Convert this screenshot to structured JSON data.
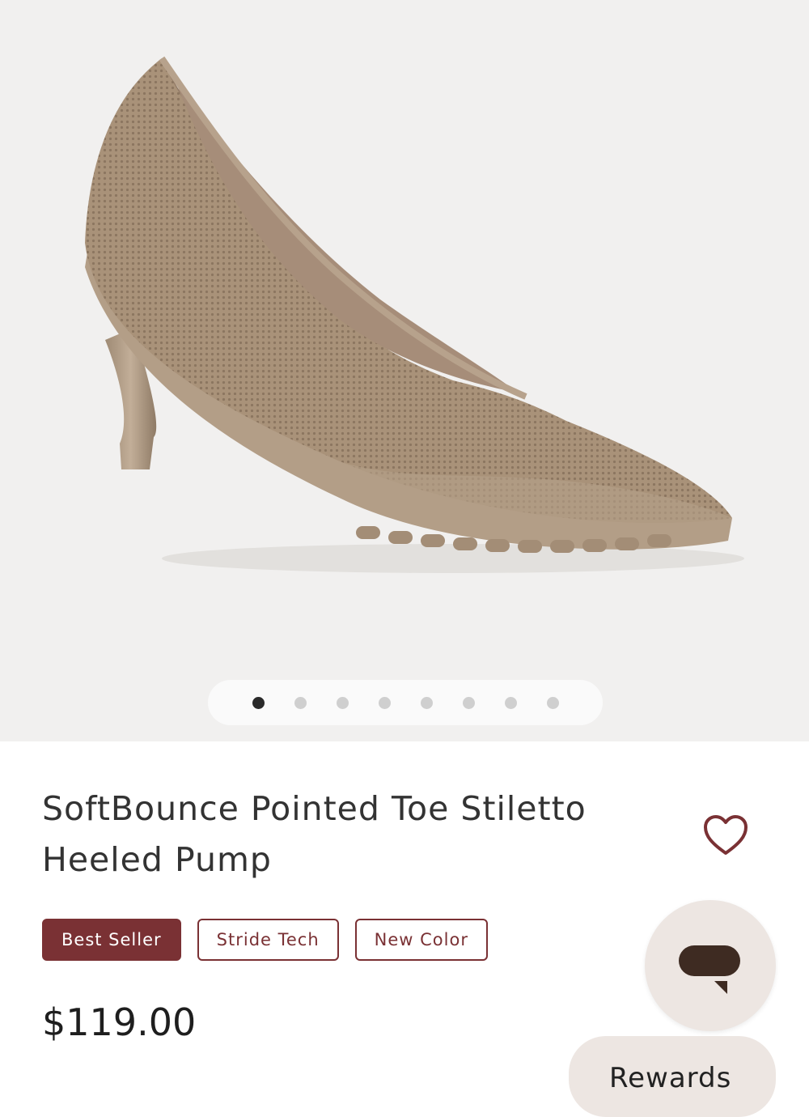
{
  "product": {
    "image_alt": "beige knit pointed toe stiletto pump",
    "carousel": {
      "total": 8,
      "active_index": 0
    },
    "title": "SoftBounce Pointed Toe Stiletto Heeled Pump",
    "badges": [
      "Best Seller",
      "Stride Tech",
      "New Color"
    ],
    "price": "$119.00"
  },
  "actions": {
    "favorite_icon": "heart-outline-icon",
    "chat_icon": "chat-bubble-icon",
    "rewards_label": "Rewards"
  },
  "colors": {
    "brand": "#7a3134",
    "shoe": "#a8927c",
    "bubble": "#ede6e2"
  }
}
